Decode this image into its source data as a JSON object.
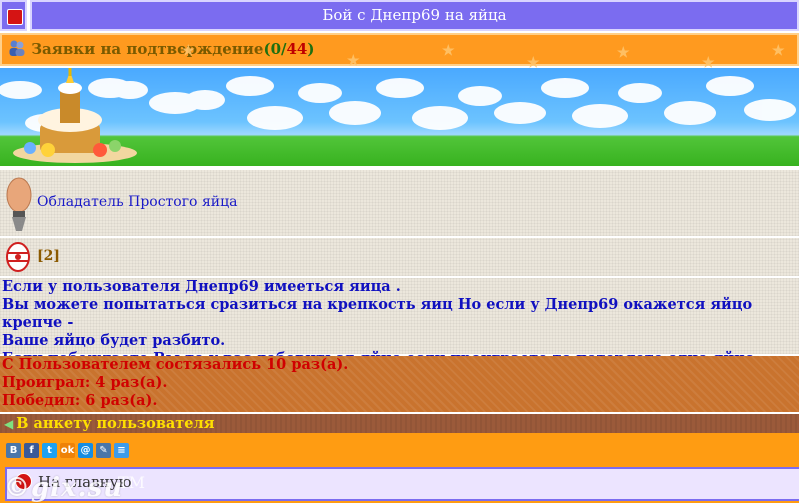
{
  "header": {
    "title": "Бой с Днепр69 на яйца"
  },
  "requests": {
    "label": "Заявки на подтверждение",
    "open": "(",
    "new_count": "0",
    "sep": "/",
    "total_count": "44",
    "close": ")"
  },
  "owner": {
    "text": "Обладатель Простого яйца"
  },
  "eggs": {
    "count": "[2]"
  },
  "info": {
    "line1": "Если у пользователя Днепр69 имееться яица .",
    "line2": "Вы можете попытаться сразиться на крепкость яиц Но если у Днепр69 окажется яйцо крепче -",
    "line3": "Ваше яйцо будет разбито.",
    "line4": "Если побеждаете Вы то у вас добовиться яйцо если проиграете то потеряете одно яйцо."
  },
  "stats": {
    "fights": "С Пользователем состязались 10 раз(а).",
    "lost": "Проиграл: 4 раз(а).",
    "won": "Победил: 6 раз(а)."
  },
  "profile_link": {
    "label": "В анкету пользователя"
  },
  "social": [
    "В",
    "f",
    "t",
    "ok",
    "@",
    "✎",
    "≡"
  ],
  "footer": {
    "main_link": "На главную",
    "watermark": "©gix.su",
    "trademark": "TM"
  },
  "colors": {
    "header": "#7b6cf0",
    "orange": "#ff9a1f",
    "info_text": "#1010c0",
    "stats_text": "#d00000",
    "profile_text": "#ffe000"
  }
}
